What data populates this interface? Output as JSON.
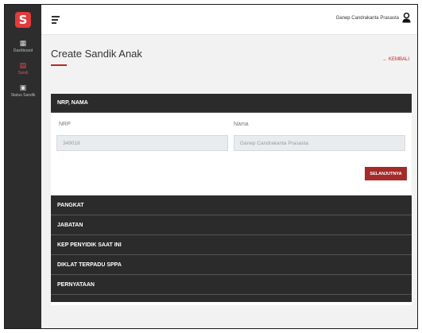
{
  "sidebar": {
    "logo": "S",
    "items": [
      {
        "label": "Dashboard",
        "icon": "dashboard-icon",
        "glyph": "▦",
        "active": false
      },
      {
        "label": "Sandi",
        "icon": "document-icon",
        "glyph": "▤",
        "active": true
      },
      {
        "label": "Status Sandik",
        "icon": "status-icon",
        "glyph": "▣",
        "active": false
      }
    ]
  },
  "topbar": {
    "user_name": "Ganep Candrakanta Prasasta",
    "user_icon": "user-icon"
  },
  "page": {
    "title": "Create Sandik Anak",
    "back_label": "← KEMBALI"
  },
  "form": {
    "section_title": "NRP, NAMA",
    "nrp_label": "NRP",
    "nrp_value": "349018",
    "nama_label": "Nama",
    "nama_value": "Ganep Candrakanta Prasasta",
    "next_button": "SELANJUTNYA"
  },
  "sections": [
    "PANGKAT",
    "JABATAN",
    "KEP PENYIDIK SAAT INI",
    "DIKLAT TERPADU SPPA",
    "PERNYATAAN"
  ],
  "colors": {
    "accent": "#a52a2a",
    "sidebar": "#2d2d2d",
    "header": "#2b2b2b"
  }
}
